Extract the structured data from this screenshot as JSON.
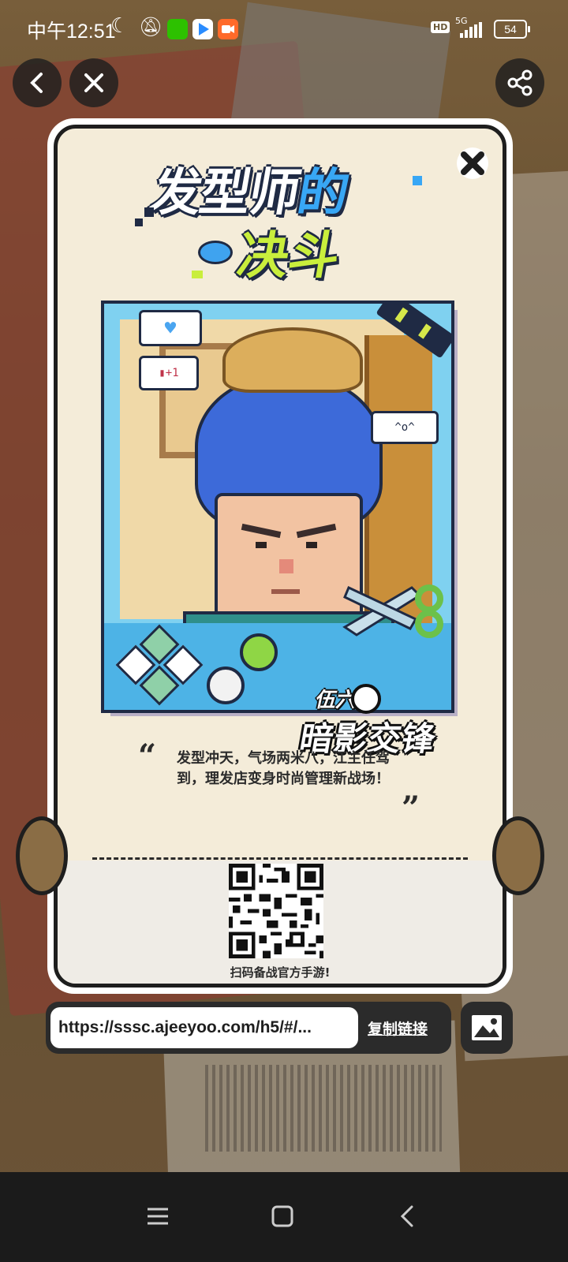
{
  "status_bar": {
    "time": "中午12:51",
    "network_label": "5G",
    "hd_label": "HD",
    "battery": "54"
  },
  "top_bar": {
    "back_icon": "chevron-left-icon",
    "close_icon": "close-icon",
    "share_icon": "share-icon"
  },
  "poster": {
    "title_line1_a": "发型师",
    "title_line1_b": "的",
    "title_line2": "决斗",
    "bubbles": {
      "heart": "♥",
      "like": "▮+1",
      "emote": "^o^"
    },
    "brand_small": "伍六",
    "brand_main": "暗影交锋",
    "quote_text": "发型冲天，气场两米八，江主任驾到，理发店变身时尚管理新战场！",
    "quote_open": "“",
    "quote_close": "”",
    "qr_hint": "扫码备战官方手游!"
  },
  "share_bar": {
    "url": "https://sssc.ajeeyoo.com/h5/#/...",
    "copy_label": "复制链接",
    "image_icon": "image-icon"
  },
  "colors": {
    "accent_blue": "#38a7f5",
    "accent_green": "#c9ee3c",
    "card_bg": "#f4ecd9",
    "dark": "#1e1e1e"
  }
}
